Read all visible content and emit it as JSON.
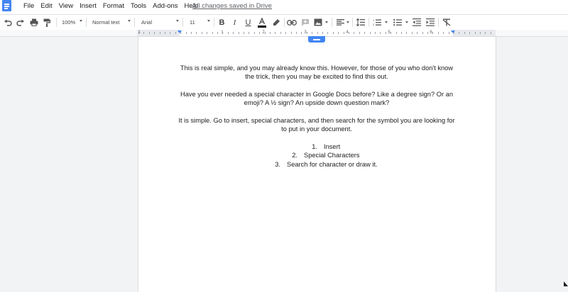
{
  "menubar": {
    "items": [
      "File",
      "Edit",
      "View",
      "Insert",
      "Format",
      "Tools",
      "Add-ons",
      "Help"
    ],
    "saved_status": "All changes saved in Drive"
  },
  "toolbar": {
    "zoom": "100%",
    "style": "Normal text",
    "font": "Arial",
    "font_size": "11",
    "text_color": "#000000",
    "icons": [
      "undo-icon",
      "redo-icon",
      "print-icon",
      "paint-format-icon",
      "bold-icon",
      "italic-icon",
      "underline-icon",
      "text-color-icon",
      "highlight-icon",
      "link-icon",
      "comment-icon",
      "image-icon",
      "align-left-icon",
      "line-spacing-icon",
      "numbered-list-icon",
      "bulleted-list-icon",
      "decrease-indent-icon",
      "increase-indent-icon",
      "clear-formatting-icon"
    ]
  },
  "ruler": {
    "numbers": [
      "1",
      "1",
      "2",
      "3",
      "4",
      "5",
      "6"
    ]
  },
  "document": {
    "paragraphs": [
      "This is real simple, and you may already know this. However, for those of you who don't know the trick, then you may be excited to find this out.",
      "Have you ever needed a special character in Google Docs before? Like a degree sign? Or an emoji? A ½ sign? An upside down question mark?",
      "It is simple. Go to insert, special characters, and then search for the symbol you are looking for to put in your document."
    ],
    "list": [
      {
        "number": "1.",
        "text": "Insert"
      },
      {
        "number": "2.",
        "text": "Special Characters"
      },
      {
        "number": "3.",
        "text": "Search for character or draw it."
      }
    ]
  },
  "colors": {
    "accent": "#4285f4",
    "background": "#f1f3f4",
    "page": "#ffffff"
  }
}
